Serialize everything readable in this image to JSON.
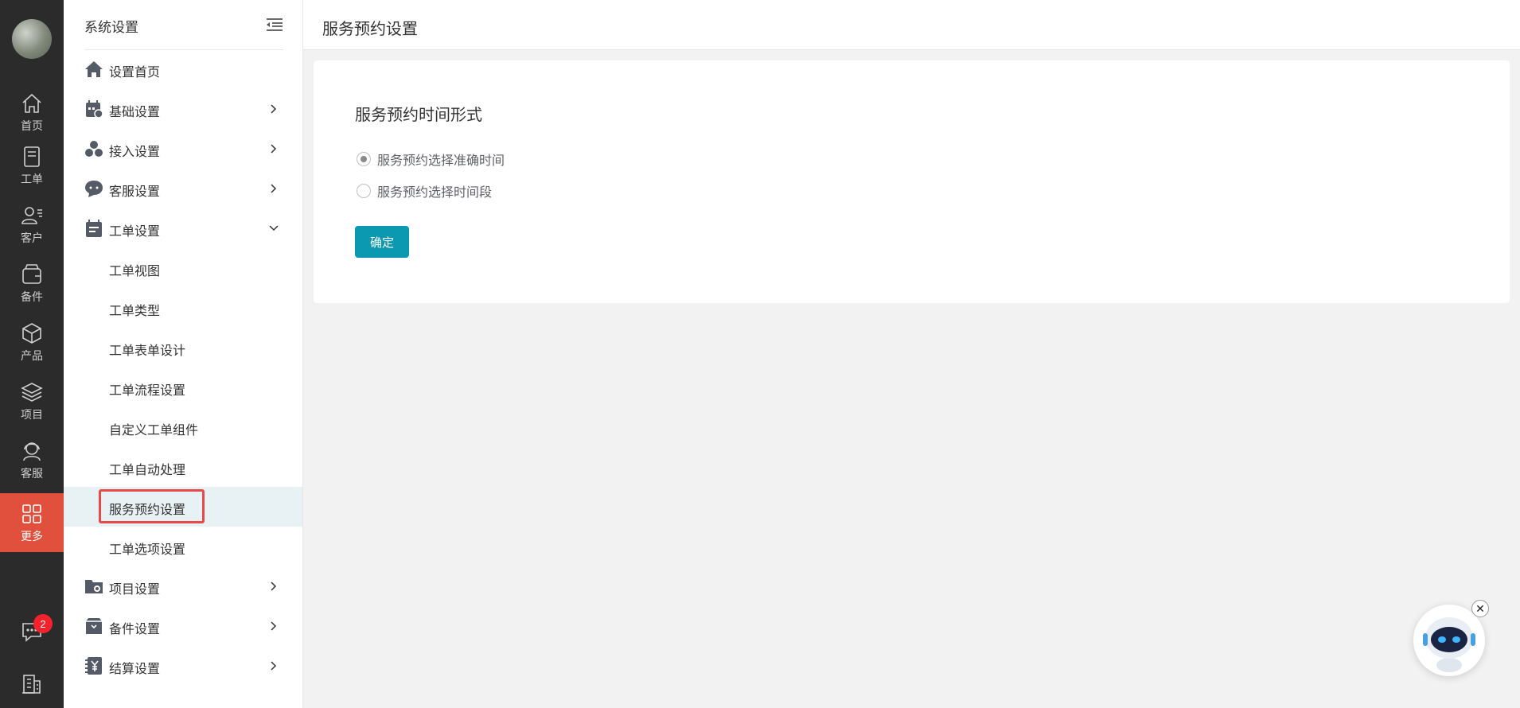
{
  "rail": {
    "items": [
      {
        "label": "首页",
        "icon": "home-icon"
      },
      {
        "label": "工单",
        "icon": "ticket-icon"
      },
      {
        "label": "客户",
        "icon": "customer-icon"
      },
      {
        "label": "备件",
        "icon": "parts-icon"
      },
      {
        "label": "产品",
        "icon": "product-icon"
      },
      {
        "label": "项目",
        "icon": "project-icon"
      },
      {
        "label": "客服",
        "icon": "service-icon"
      },
      {
        "label": "更多",
        "icon": "grid-icon"
      }
    ],
    "message_badge": "2",
    "active_color": "#e0503d"
  },
  "sidebar": {
    "title": "系统设置",
    "items": [
      {
        "label": "设置首页"
      },
      {
        "label": "基础设置"
      },
      {
        "label": "接入设置"
      },
      {
        "label": "客服设置"
      },
      {
        "label": "工单设置"
      }
    ],
    "ticket_sub": [
      {
        "label": "工单视图"
      },
      {
        "label": "工单类型"
      },
      {
        "label": "工单表单设计"
      },
      {
        "label": "工单流程设置"
      },
      {
        "label": "自定义工单组件"
      },
      {
        "label": "工单自动处理"
      },
      {
        "label": "服务预约设置"
      },
      {
        "label": "工单选项设置"
      }
    ],
    "bottom_items": [
      {
        "label": "项目设置"
      },
      {
        "label": "备件设置"
      },
      {
        "label": "结算设置"
      }
    ]
  },
  "main": {
    "page_title": "服务预约设置",
    "section_title": "服务预约时间形式",
    "options": [
      {
        "label": "服务预约选择准确时间",
        "checked": true
      },
      {
        "label": "服务预约选择时间段",
        "checked": false
      }
    ],
    "confirm_label": "确定",
    "accent": "#0b98b1"
  }
}
